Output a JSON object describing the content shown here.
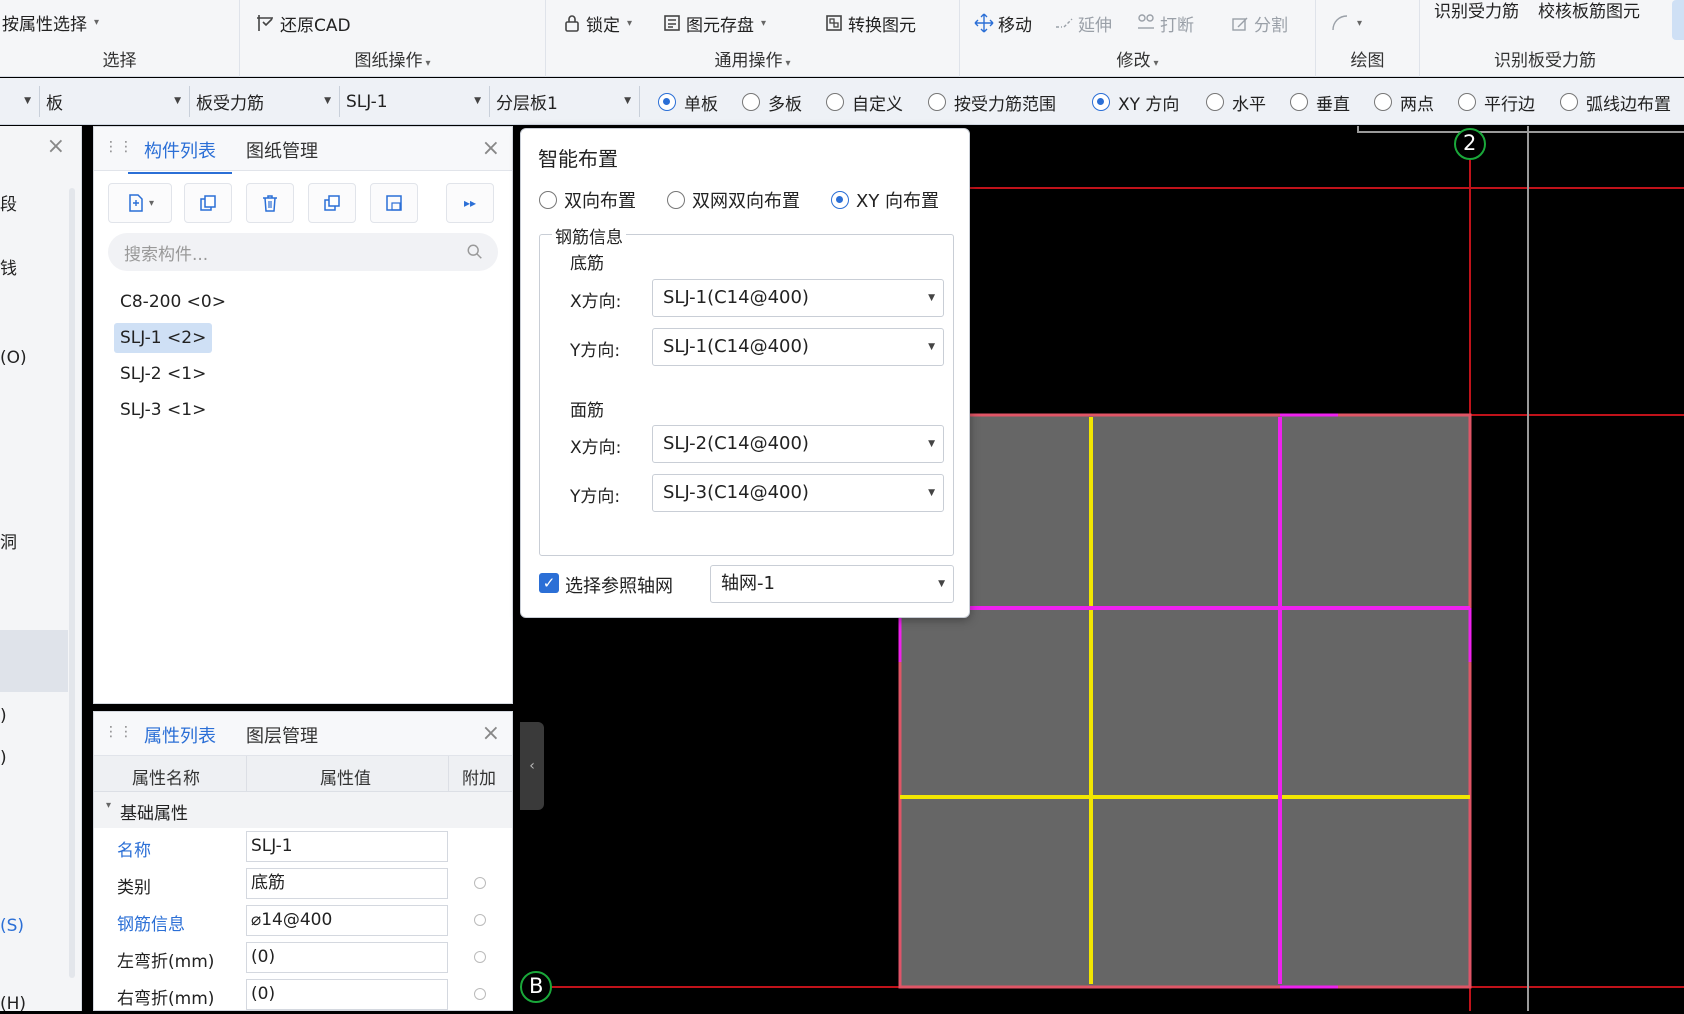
{
  "ribbon": {
    "select_by_attr": "按属性选择",
    "select_group": "选择",
    "restore_cad": "还原CAD",
    "drawing_ops_group": "图纸操作",
    "lock": "锁定",
    "save_element": "图元存盘",
    "convert_element": "转换图元",
    "general_ops_group": "通用操作",
    "move": "移动",
    "extend": "延伸",
    "break": "打断",
    "split": "分割",
    "modify_group": "修改",
    "draw_group": "绘图",
    "identify_rebar": "识别受力筋",
    "verify_rebar": "校核板筋图元",
    "identify_group": "识别板受力筋"
  },
  "optbar": {
    "combo1": "板",
    "combo2": "板受力筋",
    "combo3": "SLJ-1",
    "combo4": "分层板1",
    "radios": [
      {
        "label": "单板",
        "on": true
      },
      {
        "label": "多板",
        "on": false
      },
      {
        "label": "自定义",
        "on": false
      },
      {
        "label": "按受力筋范围",
        "on": false
      },
      {
        "label": "XY 方向",
        "on": true
      },
      {
        "label": "水平",
        "on": false
      },
      {
        "label": "垂直",
        "on": false
      },
      {
        "label": "两点",
        "on": false
      },
      {
        "label": "平行边",
        "on": false
      },
      {
        "label": "弧线边布置",
        "on": false
      }
    ]
  },
  "left_panel": {
    "items": [
      "段",
      "钱",
      "(O)",
      "洞",
      ")",
      ")",
      "(S)",
      "(H)"
    ]
  },
  "component_panel": {
    "tab_components": "构件列表",
    "tab_drawings": "图纸管理",
    "search_placeholder": "搜索构件...",
    "items": [
      "C8-200 <0>",
      "SLJ-1 <2>",
      "SLJ-2 <1>",
      "SLJ-3 <1>"
    ]
  },
  "property_panel": {
    "tab_props": "属性列表",
    "tab_layers": "图层管理",
    "col_name": "属性名称",
    "col_value": "属性值",
    "col_extra": "附加",
    "group_basic": "基础属性",
    "rows": [
      {
        "name": "名称",
        "value": "SLJ-1"
      },
      {
        "name": "类别",
        "value": "底筋"
      },
      {
        "name": "钢筋信息",
        "value": "⌀14@400"
      },
      {
        "name": "左弯折(mm)",
        "value": "(0)"
      },
      {
        "name": "右弯折(mm)",
        "value": "(0)"
      }
    ]
  },
  "dialog": {
    "title": "智能布置",
    "opt_two_way": "双向布置",
    "opt_dual_net": "双网双向布置",
    "opt_xy": "XY 向布置",
    "rebar_info": "钢筋信息",
    "bottom_rebar": "底筋",
    "top_rebar": "面筋",
    "x_dir": "X方向:",
    "y_dir": "Y方向:",
    "bottom_x": "SLJ-1(C14@400)",
    "bottom_y": "SLJ-1(C14@400)",
    "top_x": "SLJ-2(C14@400)",
    "top_y": "SLJ-3(C14@400)",
    "ref_grid_label": "选择参照轴网",
    "ref_grid_value": "轴网-1"
  },
  "canvas": {
    "axis_2": "2",
    "axis_b": "B"
  }
}
